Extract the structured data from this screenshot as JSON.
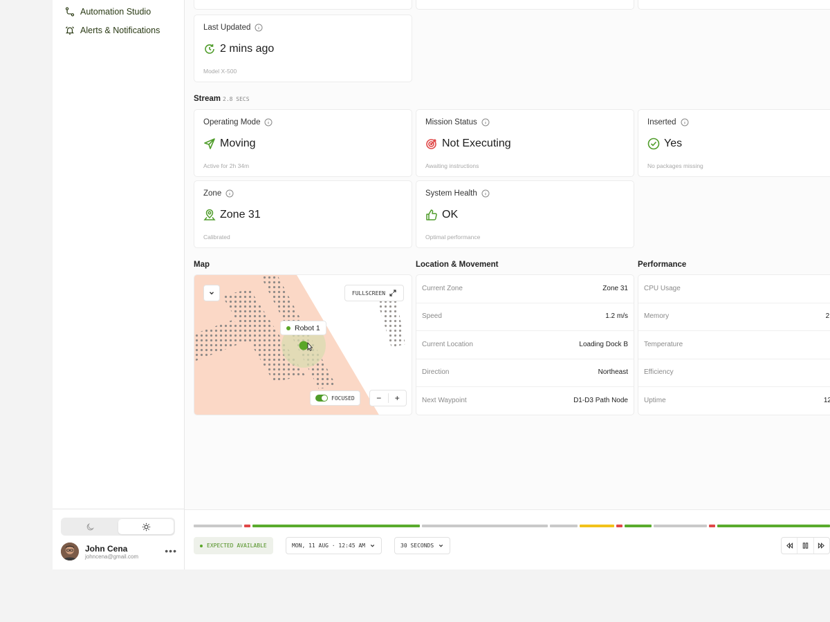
{
  "sidebar": {
    "items": [
      {
        "label": "Automation Studio",
        "icon": "route-icon"
      },
      {
        "label": "Alerts & Notifications",
        "icon": "bell-ring-icon"
      }
    ],
    "theme": {
      "modes": [
        "dark",
        "light"
      ],
      "selected": "light"
    },
    "user": {
      "name": "John Cena",
      "email": "johncena@gmail.com"
    }
  },
  "overview": {
    "last_updated": {
      "label": "Last Updated",
      "value": "2 mins ago",
      "sub": "Model X-500",
      "icon": "refresh-clock-icon"
    }
  },
  "stream": {
    "title": "Stream",
    "secs": "2.8 SECS",
    "cards": [
      {
        "label": "Operating Mode",
        "value": "Moving",
        "sub": "Active for 2h 34m",
        "icon": "send-icon"
      },
      {
        "label": "Mission Status",
        "value": "Not Executing",
        "sub": "Awaiting instructions",
        "icon": "target-icon"
      },
      {
        "label": "Inserted",
        "value": "Yes",
        "sub": "No packages missing",
        "icon": "check-circle-icon"
      },
      {
        "label": "Zone",
        "value": "Zone 31",
        "sub": "Calibrated",
        "icon": "map-pin-icon"
      },
      {
        "label": "System Health",
        "value": "OK",
        "sub": "Optimal performance",
        "icon": "thumbs-up-icon"
      }
    ]
  },
  "map": {
    "title": "Map",
    "fullscreen_label": "FULLSCREEN",
    "robot_label": "Robot 1",
    "focused_label": "FOCUSED",
    "zoom_out": "−",
    "zoom_in": "+"
  },
  "location": {
    "title": "Location & Movement",
    "rows": [
      {
        "key": "Current Zone",
        "value": "Zone 31"
      },
      {
        "key": "Speed",
        "value": "1.2 m/s"
      },
      {
        "key": "Current Location",
        "value": "Loading Dock B"
      },
      {
        "key": "Direction",
        "value": "Northeast"
      },
      {
        "key": "Next Waypoint",
        "value": "D1-D3 Path Node"
      }
    ]
  },
  "performance": {
    "title": "Performance",
    "rows": [
      {
        "key": "CPU Usage",
        "value": ""
      },
      {
        "key": "Memory",
        "value": "2."
      },
      {
        "key": "Temperature",
        "value": ""
      },
      {
        "key": "Efficiency",
        "value": ""
      },
      {
        "key": "Uptime",
        "value": "12"
      }
    ]
  },
  "timeline": {
    "status": "EXPECTED AVAILABLE",
    "datetime": "MON, 11 AUG · 12:45 AM",
    "interval": "30 SECONDS",
    "colors": {
      "idle": "#c9c9c9",
      "ok": "#5aab2e",
      "error": "#e04848",
      "warn": "#f2c21b"
    }
  }
}
